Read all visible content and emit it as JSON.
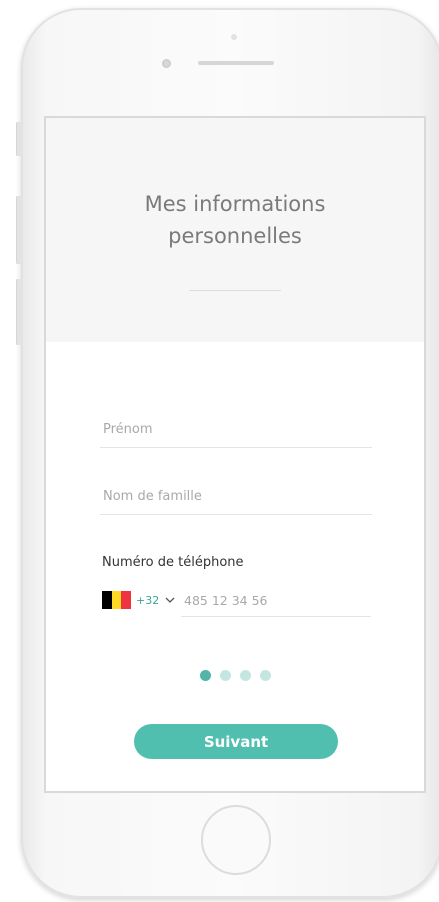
{
  "screen": {
    "title_line1": "Mes informations",
    "title_line2": "personnelles"
  },
  "form": {
    "first_name": {
      "placeholder": "Prénom",
      "value": ""
    },
    "last_name": {
      "placeholder": "Nom de famille",
      "value": ""
    },
    "phone_label": "Numéro de téléphone",
    "country_flag_icon": "belgium-flag-icon",
    "country_code": "+32",
    "phone": {
      "placeholder": "485 12 34 56",
      "value": ""
    }
  },
  "pagination": {
    "total": 4,
    "active": 1
  },
  "submit_label": "Suivant",
  "colors": {
    "accent": "#51bfb0",
    "dot_active": "#52b5a8",
    "dot_inactive": "#c4e6e1",
    "flag": [
      "#000000",
      "#fdda24",
      "#ef3340"
    ]
  }
}
